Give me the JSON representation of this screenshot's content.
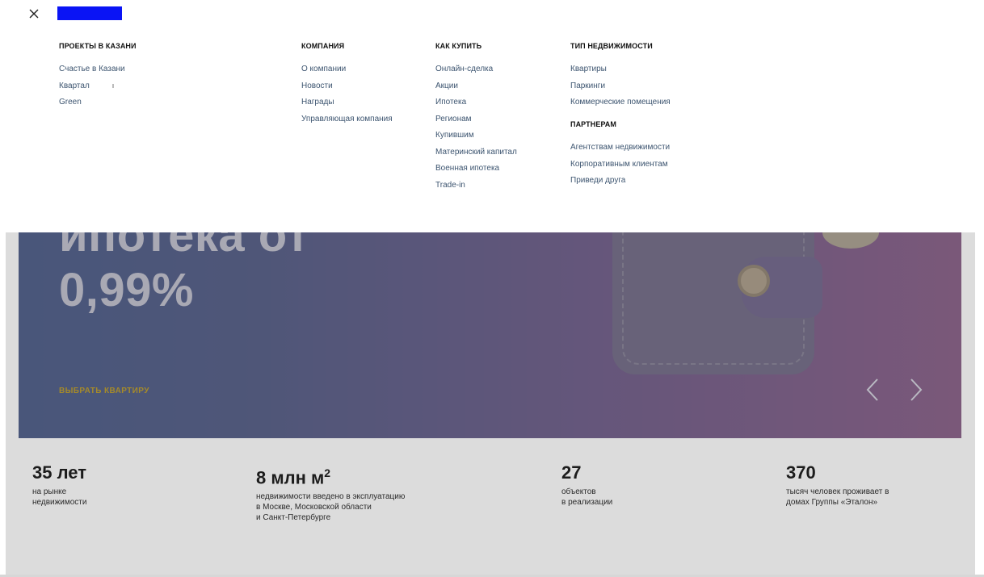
{
  "menu": {
    "close_label": "×",
    "columns": [
      {
        "title": "ПРОЕКТЫ В КАЗАНИ",
        "items": [
          "Счастье в Казани",
          "Квартал",
          "Green"
        ]
      },
      {
        "title": "КОМПАНИЯ",
        "items": [
          "О компании",
          "Новости",
          "Награды",
          "Управляющая компания"
        ]
      },
      {
        "title": "КАК КУПИТЬ",
        "items": [
          "Онлайн-сделка",
          "Акции",
          "Ипотека",
          "Регионам",
          "Купившим",
          "Материнский капитал",
          "Военная ипотека",
          "Trade-in"
        ]
      },
      {
        "title": "ТИП НЕДВИЖИМОСТИ",
        "items": [
          "Квартиры",
          "Паркинги",
          "Коммерческие помещения"
        ],
        "sub_title": "ПАРТНЕРАМ",
        "sub_items": [
          "Агентствам недвижимости",
          "Корпоративным клиентам",
          "Приведи друга"
        ]
      }
    ],
    "quarter_mark": "ı"
  },
  "hero": {
    "title_line1": "ипотека от",
    "title_line2": "0,99%",
    "cta": "ВЫБРАТЬ КВАРТИРУ"
  },
  "stats": [
    {
      "value": "35 лет",
      "caption": "на рынке\nнедвижимости"
    },
    {
      "value": "8 млн м",
      "sup": "2",
      "caption": "недвижимости введено в эксплуатацию\nв Москве, Московской области\nи Санкт-Петербурге"
    },
    {
      "value": "27",
      "caption": "объектов\nв реализации"
    },
    {
      "value": "370",
      "caption": "тысяч человек проживает в\nдомах Группы «Эталон»"
    }
  ],
  "icons": {
    "close": "close-icon",
    "prev": "chevron-left-icon",
    "next": "chevron-right-icon"
  },
  "colors": {
    "logo": "#0a14f5",
    "link": "#3d5570",
    "cta": "#a58a2a"
  }
}
